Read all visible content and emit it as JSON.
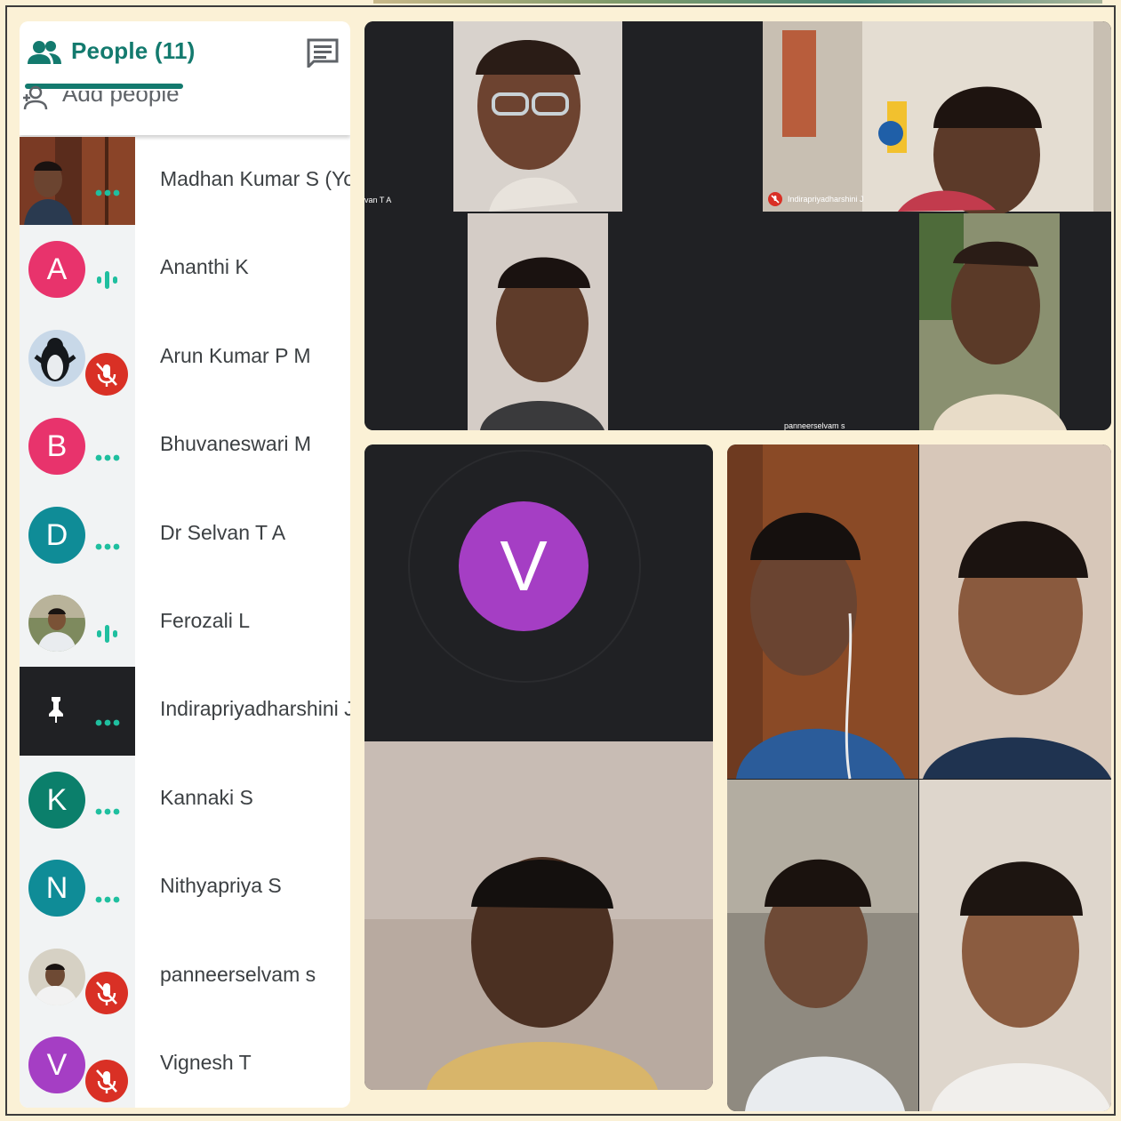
{
  "people_panel": {
    "title": "People (11)",
    "add_people_label": "Add people",
    "participants": [
      {
        "name": "Madhan Kumar S (You)",
        "avatar": "photo",
        "status": "speaking-dots-icon"
      },
      {
        "name": "Ananthi K",
        "initial": "A",
        "avatar_color": "#e8336c",
        "status": "speaking-wave-icon"
      },
      {
        "name": "Arun Kumar P M",
        "avatar": "photo",
        "status": "mic-off-icon"
      },
      {
        "name": "Bhuvaneswari M",
        "initial": "B",
        "avatar_color": "#e8336c",
        "status": "speaking-dots-icon"
      },
      {
        "name": "Dr Selvan T A",
        "initial": "D",
        "avatar_color": "#0f8c97",
        "status": "speaking-dots-icon"
      },
      {
        "name": "Ferozali L",
        "avatar": "photo",
        "status": "speaking-wave-icon"
      },
      {
        "name": "Indirapriyadharshini J",
        "avatar": "pin-icon",
        "status": "speaking-dots-icon"
      },
      {
        "name": "Kannaki S",
        "initial": "K",
        "avatar_color": "#0b7f6b",
        "status": "speaking-dots-icon"
      },
      {
        "name": "Nithyapriya S",
        "initial": "N",
        "avatar_color": "#0f8c97",
        "status": "speaking-dots-icon"
      },
      {
        "name": "panneerselvam s",
        "avatar": "photo",
        "status": "mic-off-icon"
      },
      {
        "name": "Vignesh T",
        "initial": "V",
        "avatar_color": "#a53ec4",
        "status": "mic-off-icon"
      }
    ]
  },
  "video_grid": {
    "tile_labels": [
      "van T A",
      "Indirapriyadharshini J",
      "panneerselvam s"
    ],
    "v_tile_initial": "V"
  },
  "colors": {
    "accent": "#137a6e",
    "page_background": "#fbf1d6",
    "tile_background": "#202124",
    "mute_red": "#d93025"
  }
}
